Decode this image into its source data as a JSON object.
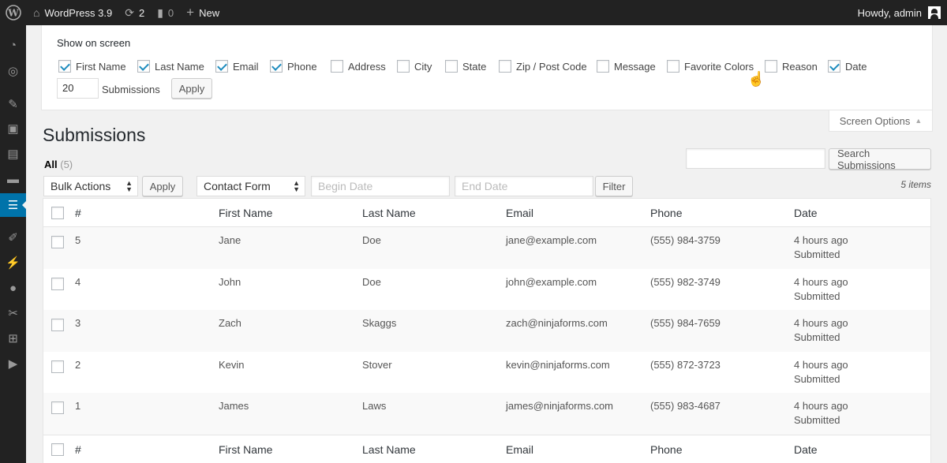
{
  "adminbar": {
    "site_name": "WordPress 3.9",
    "updates_count": "2",
    "comments_count": "0",
    "new_label": "New",
    "greeting": "Howdy, admin"
  },
  "screen_options": {
    "title": "Show on screen",
    "columns": [
      {
        "label": "First Name",
        "checked": true
      },
      {
        "label": "Last Name",
        "checked": true
      },
      {
        "label": "Email",
        "checked": true
      },
      {
        "label": "Phone",
        "checked": true
      },
      {
        "label": "Address",
        "checked": false
      },
      {
        "label": "City",
        "checked": false
      },
      {
        "label": "State",
        "checked": false
      },
      {
        "label": "Zip / Post Code",
        "checked": false
      },
      {
        "label": "Message",
        "checked": false
      },
      {
        "label": "Favorite Colors",
        "checked": false
      },
      {
        "label": "Reason",
        "checked": false
      },
      {
        "label": "Date",
        "checked": true
      }
    ],
    "per_page_value": "20",
    "per_page_label": "Submissions",
    "apply_label": "Apply",
    "tab_label": "Screen Options"
  },
  "page": {
    "title": "Submissions",
    "filter_all": "All",
    "filter_all_count": "(5)",
    "search_button": "Search Submissions",
    "search_value": ""
  },
  "tablenav": {
    "bulk_actions": "Bulk Actions",
    "apply_label": "Apply",
    "form_select": "Contact Form",
    "begin_date_placeholder": "Begin Date",
    "end_date_placeholder": "End Date",
    "filter_label": "Filter",
    "items_count": "5 items"
  },
  "table": {
    "headers": {
      "id": "#",
      "first_name": "First Name",
      "last_name": "Last Name",
      "email": "Email",
      "phone": "Phone",
      "date": "Date"
    },
    "rows": [
      {
        "id": "5",
        "first_name": "Jane",
        "last_name": "Doe",
        "email": "jane@example.com",
        "phone": "(555) 984-3759",
        "date": "4 hours ago",
        "status": "Submitted"
      },
      {
        "id": "4",
        "first_name": "John",
        "last_name": "Doe",
        "email": "john@example.com",
        "phone": "(555) 982-3749",
        "date": "4 hours ago",
        "status": "Submitted"
      },
      {
        "id": "3",
        "first_name": "Zach",
        "last_name": "Skaggs",
        "email": "zach@ninjaforms.com",
        "phone": "(555) 984-7659",
        "date": "4 hours ago",
        "status": "Submitted"
      },
      {
        "id": "2",
        "first_name": "Kevin",
        "last_name": "Stover",
        "email": "kevin@ninjaforms.com",
        "phone": "(555) 872-3723",
        "date": "4 hours ago",
        "status": "Submitted"
      },
      {
        "id": "1",
        "first_name": "James",
        "last_name": "Laws",
        "email": "james@ninjaforms.com",
        "phone": "(555) 983-4687",
        "date": "4 hours ago",
        "status": "Submitted"
      }
    ]
  },
  "colors": {
    "adminbar_bg": "#222222",
    "accent": "#0073aa",
    "checkmark": "#1e8cbe"
  }
}
